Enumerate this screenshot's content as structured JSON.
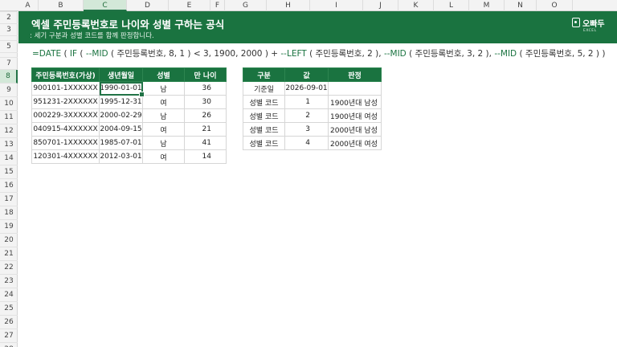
{
  "columns": [
    "A",
    "B",
    "C",
    "D",
    "E",
    "F",
    "G",
    "H",
    "I",
    "J",
    "K",
    "L",
    "M",
    "N",
    "O"
  ],
  "rows": [
    "1",
    "2",
    "3",
    "4",
    "5",
    "6",
    "7",
    "8",
    "9",
    "10",
    "11",
    "12",
    "13",
    "14",
    "15",
    "16",
    "17",
    "18",
    "19",
    "20",
    "21",
    "22",
    "23",
    "24",
    "25",
    "26",
    "27",
    "28"
  ],
  "selected_cell": {
    "column": "C",
    "row": "8"
  },
  "banner": {
    "title": "엑셀 주민등록번호로 나이와 성별 구하는 공식",
    "subtitle": ": 세기 구분과 성별 코드를 함께 판정합니다.",
    "logo_name": "오빠두",
    "logo_tag": "EXCEL"
  },
  "formula": {
    "parts": [
      {
        "t": "=DATE",
        "k": "fn"
      },
      {
        "t": " ( ",
        "k": "tx"
      },
      {
        "t": "IF",
        "k": "fn"
      },
      {
        "t": " ( ",
        "k": "tx"
      },
      {
        "t": "--MID",
        "k": "fn"
      },
      {
        "t": " ( 주민등록번호, 8, 1 ) < 3, 1900, 2000 ) + ",
        "k": "tx"
      },
      {
        "t": "--LEFT",
        "k": "fn"
      },
      {
        "t": " ( 주민등록번호, 2 ), ",
        "k": "tx"
      },
      {
        "t": "--MID",
        "k": "fn"
      },
      {
        "t": " ( 주민등록번호, 3, 2 ), ",
        "k": "tx"
      },
      {
        "t": "--MID",
        "k": "fn"
      },
      {
        "t": " ( 주민등록번호, 5, 2 ) )",
        "k": "tx"
      }
    ]
  },
  "main_table": {
    "headers": [
      "주민등록번호(가상)",
      "생년월일",
      "성별",
      "만 나이"
    ],
    "rows": [
      [
        "900101-1XXXXXX",
        "1990-01-01",
        "남",
        "36"
      ],
      [
        "951231-2XXXXXX",
        "1995-12-31",
        "여",
        "30"
      ],
      [
        "000229-3XXXXXX",
        "2000-02-29",
        "남",
        "26"
      ],
      [
        "040915-4XXXXXX",
        "2004-09-15",
        "여",
        "21"
      ],
      [
        "850701-1XXXXXX",
        "1985-07-01",
        "남",
        "41"
      ],
      [
        "120301-4XXXXXX",
        "2012-03-01",
        "여",
        "14"
      ]
    ]
  },
  "ref_table": {
    "headers": [
      "구분",
      "값",
      "판정"
    ],
    "rows": [
      [
        "기준일",
        "2026-09-01",
        ""
      ],
      [
        "성별 코드",
        "1",
        "1900년대 남성"
      ],
      [
        "성별 코드",
        "2",
        "1900년대 여성"
      ],
      [
        "성별 코드",
        "3",
        "2000년대 남성"
      ],
      [
        "성별 코드",
        "4",
        "2000년대 여성"
      ]
    ]
  },
  "colors": {
    "accent": "#1a7340",
    "selection": "#217346"
  }
}
